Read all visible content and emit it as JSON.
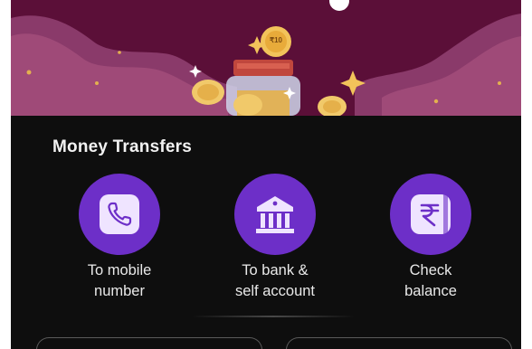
{
  "colors": {
    "background": "#0e0e0e",
    "hero": "#5a0f36",
    "accent": "#6d2fc8",
    "text": "#e9e9e9"
  },
  "hero": {
    "illustration": "coin-jar-illustration",
    "coin_label": "₹10"
  },
  "money_transfers": {
    "title": "Money Transfers",
    "actions": [
      {
        "icon": "phone-icon",
        "label": "To mobile\nnumber"
      },
      {
        "icon": "bank-icon",
        "label": "To bank &\nself account"
      },
      {
        "icon": "rupee-balance-icon",
        "label": "Check\nbalance"
      }
    ]
  }
}
